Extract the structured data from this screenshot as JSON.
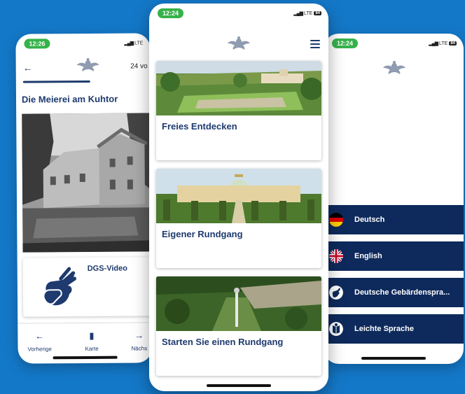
{
  "left_phone": {
    "status_time": "12:26",
    "network": "LTE",
    "page_indicator": "24 vo",
    "title": "Die Meierei am Kuhtor",
    "dgs_label": "DGS-Video",
    "nav": {
      "previous": "Vorherige",
      "map": "Karte",
      "next": "Nächs"
    }
  },
  "center_phone": {
    "status_time": "12:24",
    "network": "LTE",
    "battery": "84",
    "cards": [
      {
        "title": "Freies Entdecken"
      },
      {
        "title": "Eigener Rundgang"
      },
      {
        "title": "Starten Sie einen Rundgang"
      }
    ]
  },
  "right_phone": {
    "status_time": "12:24",
    "network": "LTE",
    "battery": "84",
    "languages": [
      {
        "label": "Deutsch",
        "icon": "german-flag-icon"
      },
      {
        "label": "English",
        "icon": "uk-flag-icon"
      },
      {
        "label": "Deutsche Gebärdenspra...",
        "icon": "sign-language-icon"
      },
      {
        "label": "Leichte Sprache",
        "icon": "easy-language-icon"
      }
    ]
  },
  "colors": {
    "background": "#1478c8",
    "brand_navy": "#0e2a5c",
    "text_navy": "#1e3a6e",
    "status_green": "#36b24a"
  }
}
